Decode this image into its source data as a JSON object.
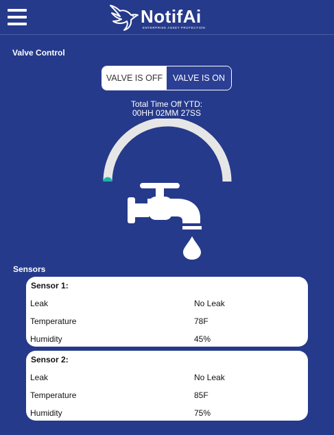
{
  "header": {
    "brand_name": "NotifAi",
    "tagline": "ENTERPRISE ASSET PROTECTION"
  },
  "valve_control": {
    "title": "Valve Control",
    "off_label": "VALVE IS OFF",
    "on_label": "VALVE IS ON",
    "selected": "VALVE IS ON",
    "time_off_label": "Total Time Off YTD:",
    "time_off_value": "00HH 02MM 27SS",
    "gauge_level": 0.0
  },
  "sensors": {
    "title": "Sensors",
    "cards": [
      {
        "title": "Sensor 1:",
        "rows": [
          {
            "label": "Leak",
            "value": "No Leak"
          },
          {
            "label": "Temperature",
            "value": "78F"
          },
          {
            "label": "Humidity",
            "value": "45%"
          }
        ]
      },
      {
        "title": "Sensor 2:",
        "rows": [
          {
            "label": "Leak",
            "value": "No Leak"
          },
          {
            "label": "Temperature",
            "value": "85F"
          },
          {
            "label": "Humidity",
            "value": "75%"
          }
        ]
      }
    ]
  },
  "colors": {
    "background": "#263a8b",
    "toggle_active": "#2b3f94",
    "gauge_track": "#e6e6e6",
    "gauge_indicator": "#1fb3a6",
    "card": "#ffffff"
  },
  "icons": {
    "menu": "hamburger-menu-icon",
    "logo": "dove-logo-icon",
    "faucet": "faucet-icon",
    "drop": "water-drop-icon"
  }
}
